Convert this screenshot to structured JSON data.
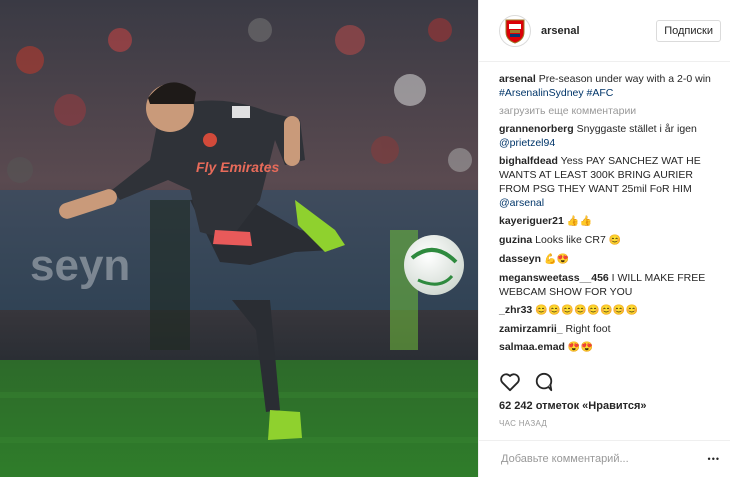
{
  "post": {
    "photo_alt": "",
    "shirt_sponsor": "Fly Emirates",
    "username": "arsenal",
    "follow_label": "Подписки",
    "caption": {
      "user": "arsenal",
      "text": "Pre-season under way with a 2-0 win",
      "hashtags": "#ArsenalinSydney #AFC"
    },
    "load_more": "загрузить еще комментарии",
    "comments": [
      {
        "user": "grannenorberg",
        "text": "Snyggaste stället i år igen",
        "tag": "@prietzel94",
        "emoji": ""
      },
      {
        "user": "bighalfdead",
        "text": "Yess PAY SANCHEZ WAT HE WANTS AT LEAST 300K BRING AURIER FROM PSG THEY WANT 25mil FoR HIM",
        "tag": "@arsenal",
        "emoji": ""
      },
      {
        "user": "kayeriguer21",
        "text": "",
        "tag": "",
        "emoji": "👍👍"
      },
      {
        "user": "guzina",
        "text": "Looks like CR7",
        "tag": "",
        "emoji": "😊"
      },
      {
        "user": "dasseyn",
        "text": "",
        "tag": "",
        "emoji": "💪😍"
      },
      {
        "user": "megansweetass__456",
        "text": "I WILL MAKE FREE WEBCAM SHOW FOR YOU",
        "tag": "",
        "emoji": ""
      },
      {
        "user": "_zhr33",
        "text": "",
        "tag": "",
        "emoji": "😊😊😊😊😊😊😊😊"
      },
      {
        "user": "zamirzamrii_",
        "text": "Right foot",
        "tag": "",
        "emoji": ""
      },
      {
        "user": "salmaa.emad",
        "text": "",
        "tag": "",
        "emoji": "😍😍"
      }
    ],
    "icons": {
      "like": "heart-icon",
      "comment": "comment-icon",
      "more": "more-icon"
    },
    "likes_text": "62 242 отметок «Нравится»",
    "time_ago": "ЧАС НАЗАД",
    "add_comment_placeholder": "Добавьте комментарий...",
    "more_glyph": "•••"
  }
}
